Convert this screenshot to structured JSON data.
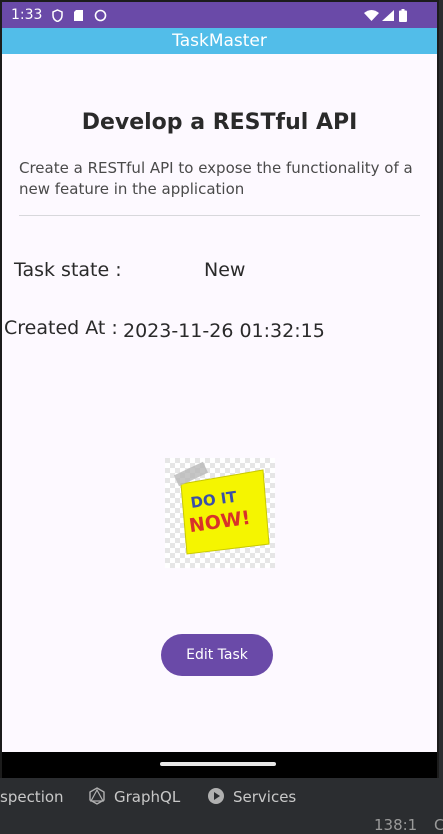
{
  "status_bar": {
    "time": "1:33"
  },
  "app_bar": {
    "title": "TaskMaster"
  },
  "task": {
    "title": "Develop a RESTful API",
    "description": "Create a RESTful API to expose the functionality of a new feature in the application",
    "state_label": "Task state :",
    "state_value": "New",
    "created_label": "Created At :",
    "created_value": "2023-11-26 01:32:15",
    "image_text_line1": "DO IT",
    "image_text_line2": "NOW!"
  },
  "actions": {
    "edit_label": "Edit Task"
  },
  "ide": {
    "tabs": [
      {
        "label": "spection"
      },
      {
        "label": "GraphQL",
        "icon": "graphql-icon"
      },
      {
        "label": "Services",
        "icon": "services-icon"
      }
    ],
    "cursor_position": "138:1",
    "status_trailing": "C"
  },
  "colors": {
    "status_bar": "#6a4aa8",
    "app_bar": "#52bde9",
    "button": "#6a4aa8",
    "background": "#fdf9ff"
  }
}
